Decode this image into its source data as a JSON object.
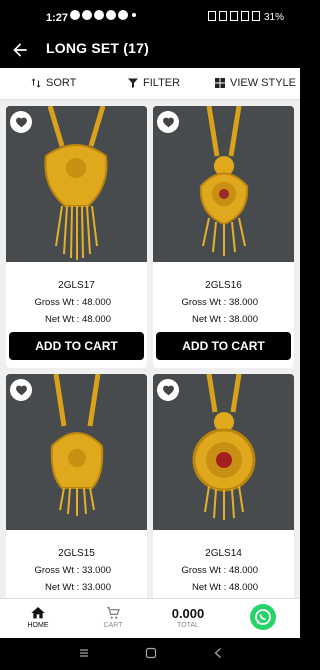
{
  "status_bar": {
    "time": "1:27",
    "battery": "31%"
  },
  "header": {
    "title": "LONG SET (17)"
  },
  "toolbar": {
    "sort_label": "SORT",
    "filter_label": "FILTER",
    "view_style_label": "VIEW STYLE"
  },
  "labels": {
    "gross_prefix": "Gross Wt : ",
    "net_prefix": "Net Wt : ",
    "add_to_cart": "ADD TO CART"
  },
  "products": [
    {
      "code": "2GLS17",
      "gross_wt": "48.000",
      "net_wt": "48.000"
    },
    {
      "code": "2GLS16",
      "gross_wt": "38.000",
      "net_wt": "38.000"
    },
    {
      "code": "2GLS15",
      "gross_wt": "33.000",
      "net_wt": "33.000"
    },
    {
      "code": "2GLS14",
      "gross_wt": "48.000",
      "net_wt": "48.000"
    }
  ],
  "bottom_nav": {
    "home_label": "HOME",
    "cart_label": "CART",
    "total_value": "0.000",
    "total_label": "TOTAL"
  },
  "colors": {
    "accent": "#000000",
    "whatsapp": "#25d366",
    "gold": "#e0a81c"
  }
}
